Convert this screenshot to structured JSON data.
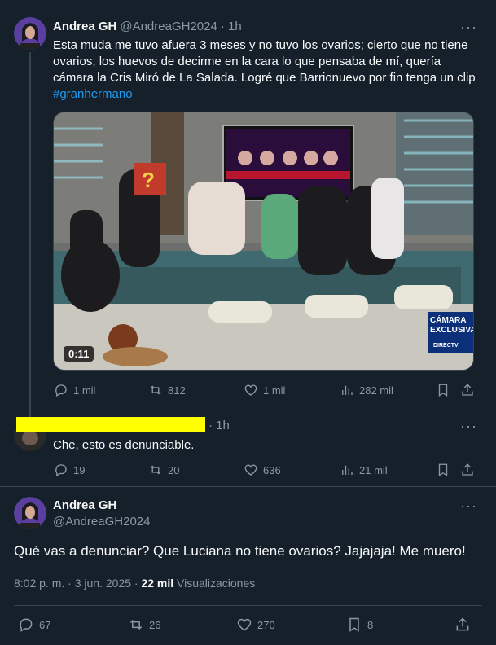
{
  "tweet1": {
    "name": "Andrea GH",
    "handle": "@AndreaGH2024",
    "time": "· 1h",
    "text": "Esta muda me tuvo afuera 3 meses y no tuvo los ovarios; cierto que no tiene ovarios, los huevos de decirme en la cara lo que pensaba de mí, quería cámara la Cris Miró de La Salada. Logré que Barrionuevo por fin tenga un clip ",
    "hashtag": "#granhermano",
    "video_time": "0:11",
    "video_overlay": "CÁMARA EXCLUSIVA",
    "video_logo": "DIRECTV",
    "replies": "1 mil",
    "retweets": "812",
    "likes": "1 mil",
    "views": "282 mil"
  },
  "tweet2": {
    "time": "· 1h",
    "text": "Che, esto es denunciable.",
    "replies": "19",
    "retweets": "20",
    "likes": "636",
    "views": "21 mil"
  },
  "tweet3": {
    "name": "Andrea GH",
    "handle": "@AndreaGH2024",
    "text": "Qué vas a denunciar? Que Luciana no tiene ovarios? Jajajaja! Me muero!",
    "timestamp": "8:02 p. m. · 3 jun. 2025 · ",
    "views_count": "22 mil",
    "views_label": " Visualizaciones",
    "replies": "67",
    "retweets": "26",
    "likes": "270",
    "bookmarks": "8"
  },
  "icons": {
    "reply": "reply-icon",
    "retweet": "retweet-icon",
    "like": "heart-icon",
    "views": "views-icon",
    "bookmark": "bookmark-icon",
    "share": "share-icon",
    "more": "more-icon"
  },
  "colors": {
    "background": "#15202b",
    "accent": "#1d9bf0",
    "muted": "#8b98a5",
    "redaction": "#ffff00"
  }
}
